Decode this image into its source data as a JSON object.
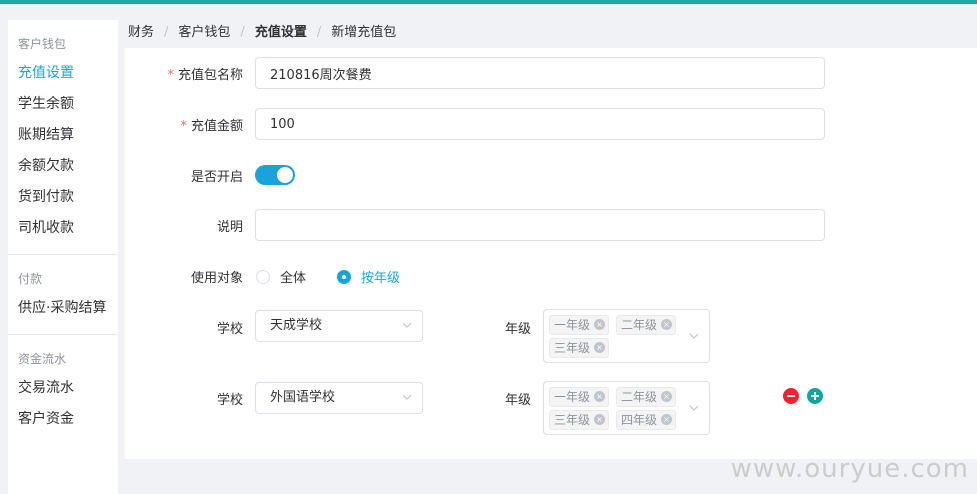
{
  "sidebar": {
    "groups": [
      {
        "title": "客户钱包",
        "items": [
          "充值设置",
          "学生余额",
          "账期结算",
          "余额欠款",
          "货到付款",
          "司机收款"
        ]
      },
      {
        "title": "付款",
        "items": [
          "供应·采购结算"
        ]
      },
      {
        "title": "资金流水",
        "items": [
          "交易流水",
          "客户资金"
        ]
      }
    ],
    "active_item": "充值设置"
  },
  "breadcrumb": {
    "c1": "财务",
    "c2": "客户钱包",
    "c3": "充值设置",
    "c4": "新增充值包",
    "sep": "/"
  },
  "form": {
    "name_label": "充值包名称",
    "name_value": "210816周次餐费",
    "amount_label": "充值金额",
    "amount_value": "100",
    "enabled_label": "是否开启",
    "enabled": true,
    "desc_label": "说明",
    "desc_value": "",
    "target_label": "使用对象",
    "target_options": [
      "全体",
      "按年级"
    ],
    "target_selected": "按年级",
    "required_mark": "*"
  },
  "school_rows": [
    {
      "school_label": "学校",
      "school": "天成学校",
      "grade_label": "年级",
      "grades": [
        "一年级",
        "二年级",
        "三年级"
      ]
    },
    {
      "school_label": "学校",
      "school": "外国语学校",
      "grade_label": "年级",
      "grades": [
        "一年级",
        "二年级",
        "三年级",
        "四年级"
      ]
    }
  ],
  "tag_close": "×",
  "watermark": "www.ouryue.com",
  "colors": {
    "accent": "#1aa3db",
    "topbar": "#1fa7a1",
    "required": "#f56c6c",
    "minus": "#f5222d",
    "plus": "#13a4a0"
  }
}
